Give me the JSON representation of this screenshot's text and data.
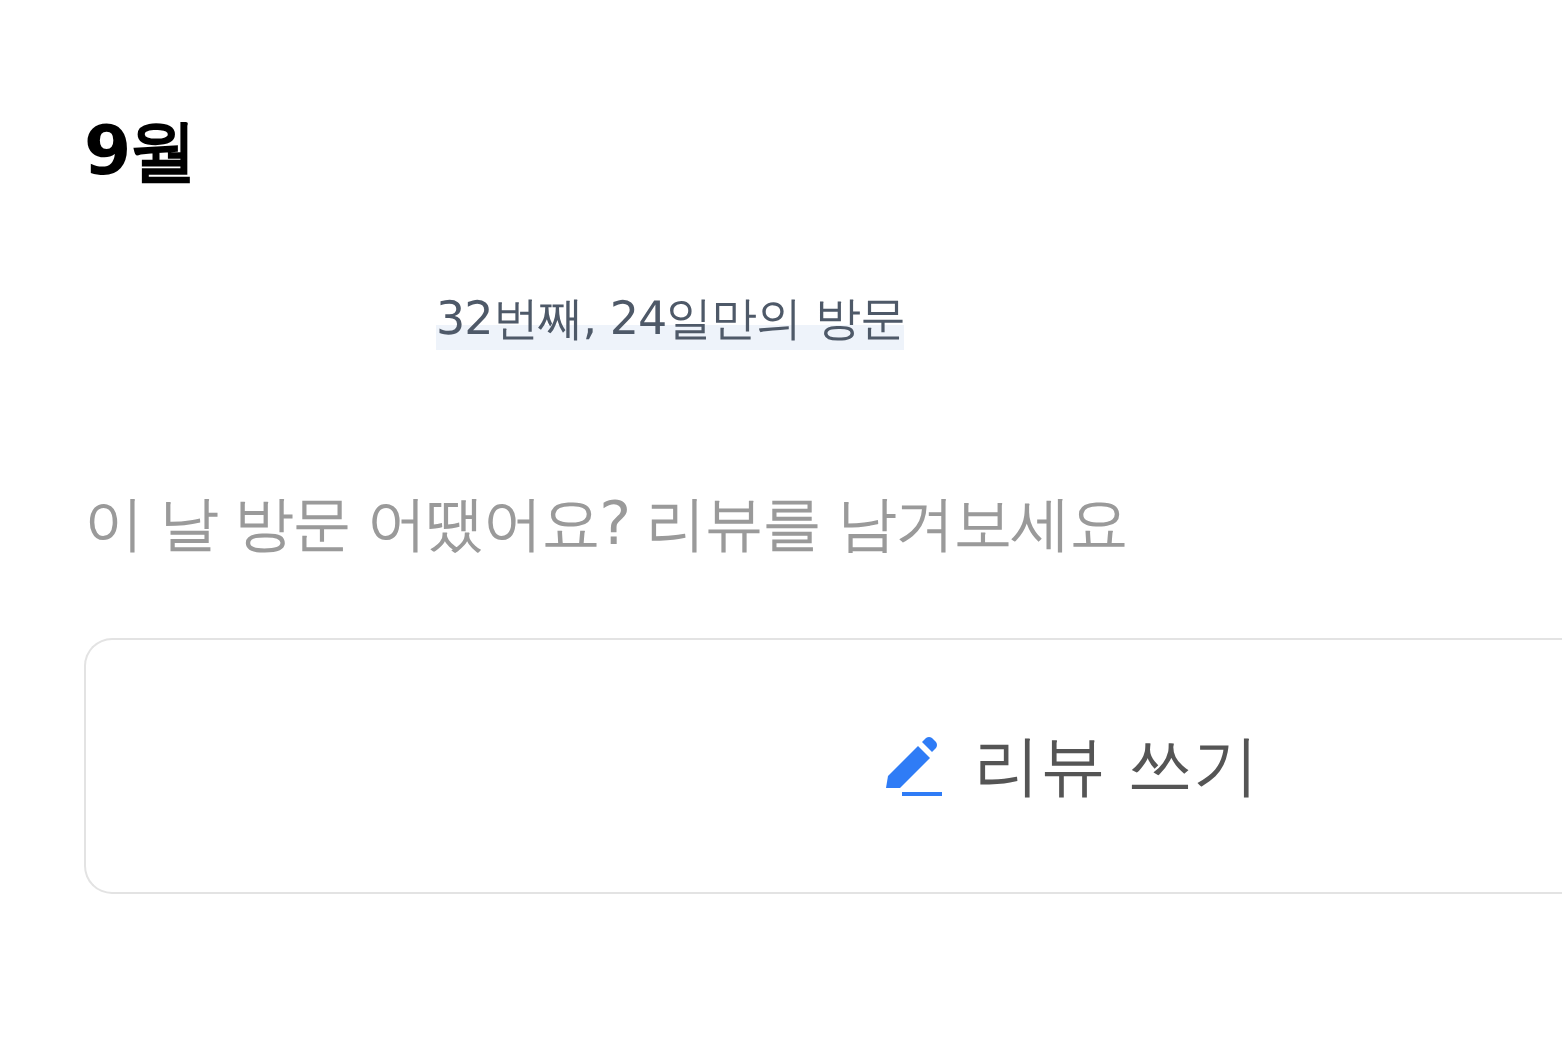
{
  "heading": "9월",
  "visit_info": "32번째, 24일만의 방문",
  "prompt": "이 날 방문 어땠어요? 리뷰를 남겨보세요",
  "review_button": {
    "label": "리뷰 쓰기"
  }
}
